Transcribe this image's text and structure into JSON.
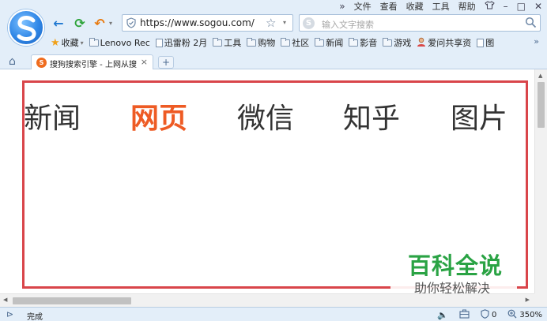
{
  "menubar": {
    "expand_symbol": "»",
    "items": [
      "文件",
      "查看",
      "收藏",
      "工具",
      "帮助"
    ],
    "skin_icon": "shirt-icon",
    "minimize_symbol": "–",
    "maximize_symbol": "□",
    "close_symbol": "✕"
  },
  "toolbar": {
    "back_symbol": "←",
    "refresh_symbol": "⟳",
    "undo_symbol": "↶",
    "dropdown_symbol": "▾"
  },
  "address": {
    "url": "https://www.sogou.com/",
    "star_symbol": "☆",
    "dropdown_symbol": "▾"
  },
  "search": {
    "engine_letter": "S",
    "placeholder": "输入文字搜索"
  },
  "bookmarks": {
    "favorites_label": "收藏",
    "favorites_star": "★",
    "dropdown_symbol": "▾",
    "items": [
      {
        "label": "Lenovo Rec",
        "icon": "folder-icon"
      },
      {
        "label": "迅雷粉 2月",
        "icon": "page-icon"
      },
      {
        "label": "工具",
        "icon": "folder-icon"
      },
      {
        "label": "购物",
        "icon": "folder-icon"
      },
      {
        "label": "社区",
        "icon": "folder-icon"
      },
      {
        "label": "新闻",
        "icon": "folder-icon"
      },
      {
        "label": "影音",
        "icon": "folder-icon"
      },
      {
        "label": "游戏",
        "icon": "folder-icon"
      },
      {
        "label": "爱问共享资",
        "icon": "avatar-icon"
      },
      {
        "label": "图",
        "icon": "page-icon"
      }
    ],
    "more_symbol": "»"
  },
  "tabs": {
    "home_symbol": "⌂",
    "active": {
      "favicon_letter": "S",
      "title": "搜狗搜索引擎 - 上网从搜"
    },
    "close_symbol": "×",
    "new_tab_symbol": "+"
  },
  "page": {
    "nav": [
      "新闻",
      "网页",
      "微信",
      "知乎",
      "图片"
    ],
    "active_nav": "网页",
    "frame_color": "#d9454a",
    "active_color": "#ee5b24"
  },
  "watermark": {
    "title": "百科全说",
    "subtitle": "助你轻松解决",
    "color": "#2aa344"
  },
  "scroll": {
    "up_symbol": "▲",
    "left_symbol": "◀",
    "right_symbol": "▶"
  },
  "statusbar": {
    "toggle_symbol": "⊳",
    "text": "完成",
    "sound_symbol": "🔈",
    "shield_count": "0",
    "zoom": "350%"
  }
}
